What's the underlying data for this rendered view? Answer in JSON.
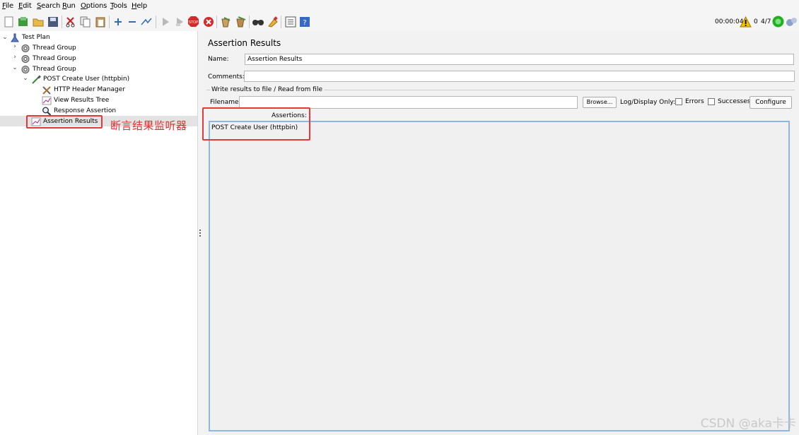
{
  "menubar": {
    "items": [
      {
        "first": "F",
        "rest": "ile"
      },
      {
        "first": "E",
        "rest": "dit"
      },
      {
        "first": "S",
        "rest": "earch"
      },
      {
        "first": "R",
        "rest": "un"
      },
      {
        "first": "O",
        "rest": "ptions"
      },
      {
        "first": "T",
        "rest": "ools"
      },
      {
        "first": "H",
        "rest": "elp"
      }
    ]
  },
  "toolbar": {
    "elapsed": "00:00:04",
    "warnings": "0",
    "threads": "4/7",
    "stop_label": "STOP"
  },
  "tree": {
    "root": "Test Plan",
    "thread_group_1": "Thread Group",
    "thread_group_2": "Thread Group",
    "thread_group_3": "Thread Group",
    "sampler": "POST Create User (httpbin)",
    "header_manager": "HTTP Header Manager",
    "view_results_tree": "View Results Tree",
    "response_assertion": "Response Assertion",
    "assertion_results": "Assertion Results"
  },
  "annotation": "断言结果监听器",
  "panel": {
    "title": "Assertion Results",
    "name_label": "Name:",
    "name_value": "Assertion Results",
    "comments_label": "Comments:",
    "comments_value": "",
    "write_group": "Write results to file / Read from file",
    "filename_label": "Filename",
    "filename_value": "",
    "browse": "Browse...",
    "log_display": "Log/Display Only:",
    "errors": "Errors",
    "successes": "Successes",
    "configure": "Configure",
    "assertions_label": "Assertions:",
    "assertion_entry": "POST Create User (httpbin)"
  },
  "colors": {
    "highlight": "#e23a3a",
    "selection": "#e3e3e3",
    "focus_border": "#8fb6e4",
    "running": "#22b022"
  },
  "watermark": "CSDN @aka卡卡"
}
